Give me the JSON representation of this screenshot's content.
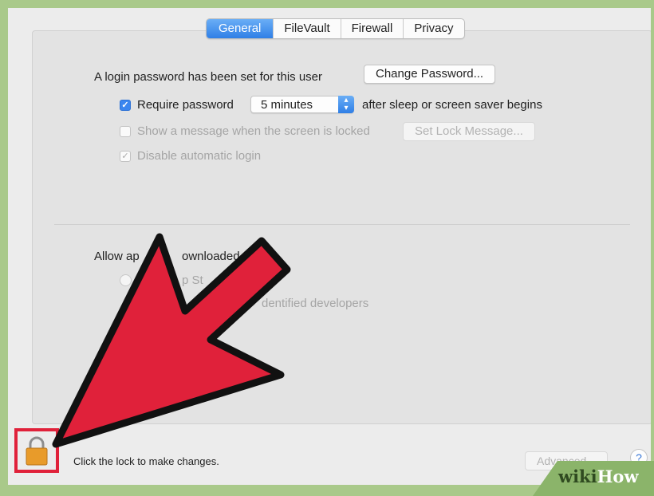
{
  "tabs": [
    {
      "label": "General",
      "active": true
    },
    {
      "label": "FileVault",
      "active": false
    },
    {
      "label": "Firewall",
      "active": false
    },
    {
      "label": "Privacy",
      "active": false
    }
  ],
  "login": {
    "text": "A login password has been set for this user",
    "change_button": "Change Password..."
  },
  "require_password": {
    "label": "Require password",
    "checked": true,
    "select_value": "5 minutes",
    "suffix": "after sleep or screen saver begins"
  },
  "show_message": {
    "label": "Show a message when the screen is locked",
    "checked": false,
    "button": "Set Lock Message..."
  },
  "disable_login": {
    "label": "Disable automatic login",
    "checked": true
  },
  "allow_apps": {
    "label_visible": "Allow ap",
    "label_visible_2": "ownloaded f",
    "option1_visible": "p St",
    "option2_visible": "dentified developers"
  },
  "footer": {
    "lock_text": "Click the lock to make changes.",
    "advanced_button": "Advanced...",
    "help": "?"
  },
  "watermark": {
    "part1": "wiki",
    "part2": "How"
  },
  "colors": {
    "accent": "#2f7fe6",
    "arrow": "#e0213a",
    "lock": "#e89b2a"
  }
}
